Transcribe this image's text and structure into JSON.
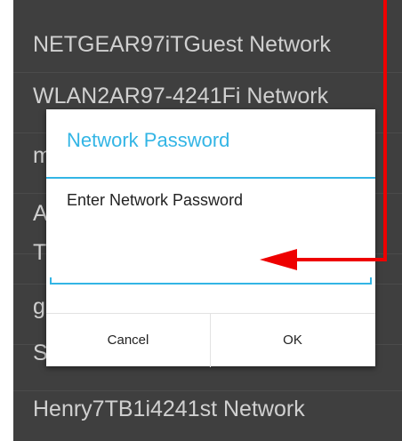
{
  "network_list": [
    {
      "name": "NETGEAR97iTGuest Network"
    },
    {
      "name": "WLAN2AR97-4241Fi Network"
    },
    {
      "name": "m"
    },
    {
      "name": "A"
    },
    {
      "name": "T"
    },
    {
      "name": "g"
    },
    {
      "name": "S"
    },
    {
      "name": "Henry7TB1i4241st Network"
    }
  ],
  "dialog": {
    "title": "Network Password",
    "message": "Enter Network Password",
    "password_value": "",
    "cancel_label": "Cancel",
    "ok_label": "OK"
  },
  "colors": {
    "accent": "#33b5e5",
    "background": "#3f3f3f",
    "annotation_arrow": "#ee0000"
  }
}
